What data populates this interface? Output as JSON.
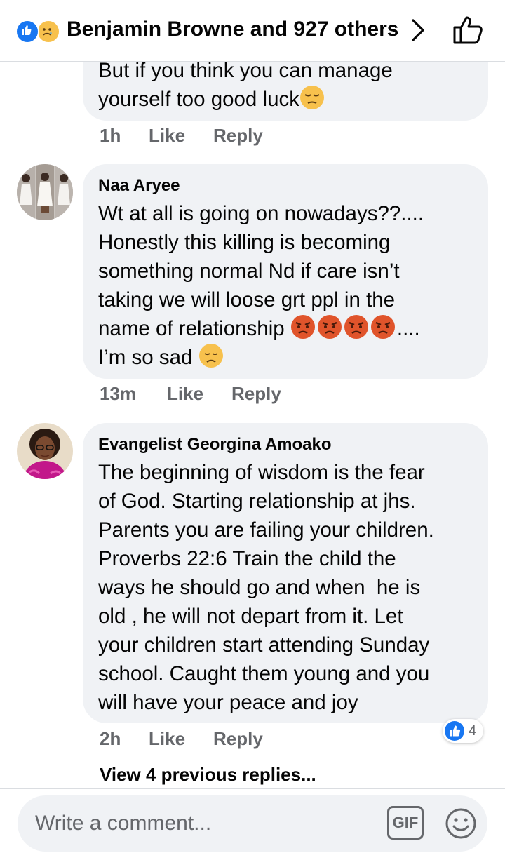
{
  "header": {
    "reactors_text": "Benjamin Browne and 927 others",
    "icons": [
      "like-reaction-icon",
      "sad-reaction-icon",
      "chevron-right-icon",
      "thumbs-up-outline-icon"
    ]
  },
  "comments": [
    {
      "author": "",
      "lines": [
        "But if you think you can manage",
        "yourself too good luck"
      ],
      "time": "1h",
      "like_label": "Like",
      "reply_label": "Reply"
    },
    {
      "author": "Naa Aryee",
      "lines": [
        "Wt at all is going on nowadays??....",
        "Honestly this killing is becoming",
        "something normal Nd if care isn’t",
        "taking we will loose grt ppl in the",
        "name of relationship",
        "....",
        "I’m so sad"
      ],
      "time": "13m",
      "like_label": "Like",
      "reply_label": "Reply"
    },
    {
      "author": "Evangelist Georgina Amoako",
      "lines": [
        "The beginning of wisdom is the fear",
        "of God. Starting relationship at jhs.",
        "Parents you are failing your children.",
        "Proverbs 22:6 Train the child the",
        "ways he should go and when  he is",
        "old , he will not depart from it. Let",
        "your children start attending Sunday",
        "school. Caught them young and you",
        "will have your peace and joy"
      ],
      "time": "2h",
      "like_label": "Like",
      "reply_label": "Reply",
      "reaction_count": "4"
    }
  ],
  "view_previous_replies": "View 4 previous replies...",
  "composer": {
    "placeholder": "Write a comment...",
    "gif_label": "GIF"
  },
  "colors": {
    "facebook_blue": "#1877f2",
    "bubble_bg": "#f0f2f5",
    "meta_gray": "#65676b",
    "angry_emoji": "#e0542b",
    "sad_emoji": "#f7c14d"
  }
}
